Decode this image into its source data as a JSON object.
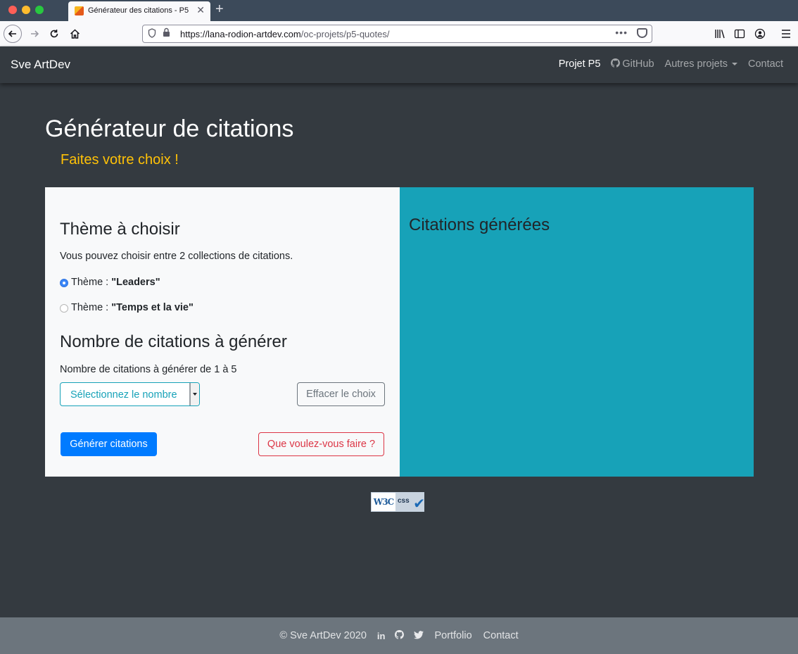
{
  "browser": {
    "tab_title": "Générateur des citations - P5",
    "tab_close": "✕",
    "new_tab": "+",
    "url_prefix": "https://lana-rodion-artdev.com",
    "url_path": "/oc-projets/p5-quotes/",
    "url_more": "•••"
  },
  "navbar": {
    "brand": "Sve ArtDev",
    "links": [
      {
        "label": "Projet P5"
      },
      {
        "label": "GitHub"
      },
      {
        "label": "Autres projets"
      },
      {
        "label": "Contact"
      }
    ]
  },
  "header": {
    "title": "Générateur de citations",
    "subtitle": "Faites votre choix !"
  },
  "form": {
    "theme_heading": "Thème à choisir",
    "theme_intro": "Vous pouvez choisir entre 2 collections de citations.",
    "theme_prefix": "Thème : ",
    "options": [
      {
        "label": "\"Leaders\"",
        "checked": true
      },
      {
        "label": "\"Temps et la vie\"",
        "checked": false
      }
    ],
    "count_heading": "Nombre de citations à générer",
    "count_help": "Nombre de citations à générer de 1 à 5",
    "select_label": "Sélectionnez le nombre",
    "clear_button": "Effacer le choix",
    "generate_button": "Générer citations",
    "help_button": "Que voulez-vous faire ?"
  },
  "results": {
    "heading": "Citations générées"
  },
  "badge": {
    "left": "W3C",
    "right": "css"
  },
  "footer": {
    "copyright": "© Sve ArtDev 2020",
    "icons": [
      "linkedin-icon",
      "github-icon",
      "twitter-icon"
    ],
    "icon_glyphs": [
      "in",
      "◉",
      "🐦"
    ],
    "links": [
      "Portfolio",
      "Contact"
    ]
  },
  "colors": {
    "accent_primary": "#007bff",
    "accent_info": "#17a2b8",
    "accent_warning": "#ffc107",
    "accent_danger": "#dc3545",
    "dark": "#343a40"
  }
}
